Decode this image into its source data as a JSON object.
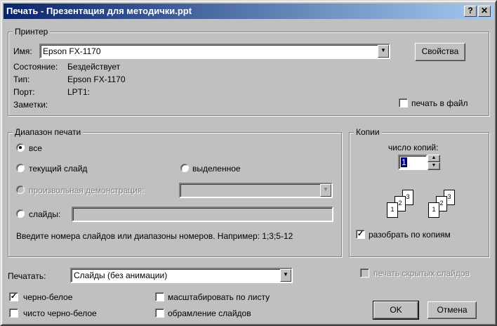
{
  "window": {
    "title": "Печать - Презентация для методички.ppt",
    "help_btn": "?",
    "close_btn": "✕"
  },
  "printer": {
    "legend": "Принтер",
    "name_label": "Имя:",
    "name_value": "Epson FX-1170",
    "properties_btn": "Свойства",
    "status_label": "Состояние:",
    "status_value": "Бездействует",
    "type_label": "Тип:",
    "type_value": "Epson FX-1170",
    "port_label": "Порт:",
    "port_value": "LPT1:",
    "notes_label": "Заметки:",
    "print_to_file": "печать в файл"
  },
  "range": {
    "legend": "Диапазон печати",
    "all": "все",
    "current": "текущий слайд",
    "selection": "выделенное",
    "custom_show": "произвольная демонстрация:",
    "slides": "слайды:",
    "slides_value": "",
    "hint": "Введите номера слайдов или диапазоны номеров. Например: 1;3;5-12"
  },
  "copies": {
    "legend": "Копии",
    "count_label": "число копий:",
    "count_value": "1",
    "collate": "разобрать по копиям",
    "collate_checked": true
  },
  "print_what": {
    "label": "Печатать:",
    "value": "Слайды (без анимации)"
  },
  "print_hidden": "печать скрытых слайдов",
  "options": {
    "grayscale": "черно-белое",
    "grayscale_checked": true,
    "pure_bw": "чисто черно-белое",
    "scale_to_fit": "масштабировать по листу",
    "frame_slides": "обрамление слайдов"
  },
  "buttons": {
    "ok": "OK",
    "cancel": "Отмена"
  }
}
